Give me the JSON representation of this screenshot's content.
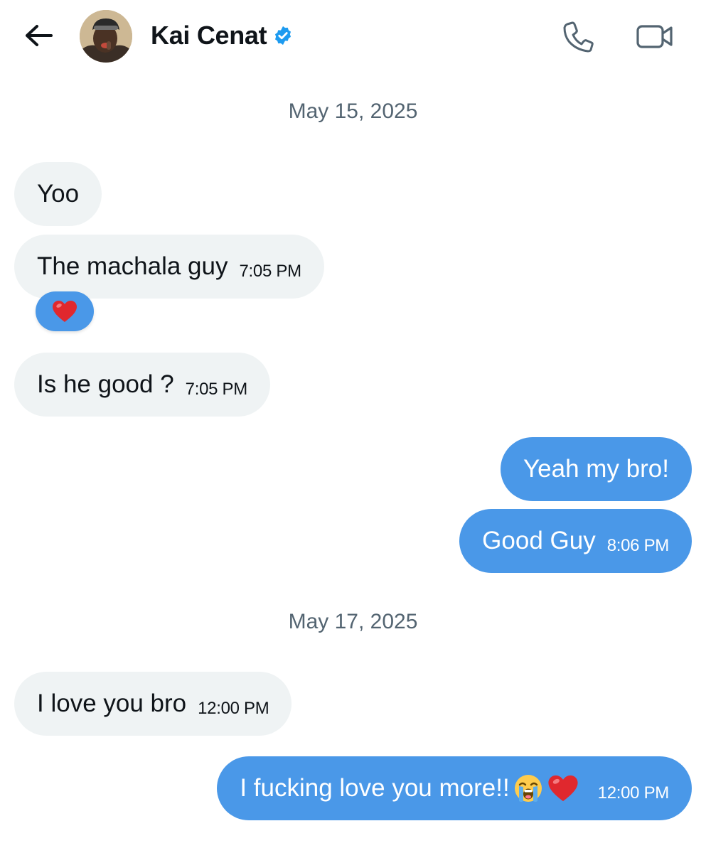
{
  "header": {
    "back_icon": "arrow-left-icon",
    "contact_name": "Kai Cenat",
    "verified_icon": "verified-badge-icon",
    "call_icon": "phone-icon",
    "video_icon": "video-camera-icon"
  },
  "colors": {
    "outgoing_bubble": "#4a98e8",
    "incoming_bubble": "#eff3f4",
    "verified_blue": "#1d9bf0",
    "date_text": "#536471"
  },
  "conversation": {
    "date_1": "May 15, 2025",
    "date_2": "May 17, 2025",
    "messages": [
      {
        "direction": "incoming",
        "text": "Yoo",
        "time": ""
      },
      {
        "direction": "incoming",
        "text": "The machala guy",
        "time": "7:05 PM",
        "reaction": "red-heart"
      },
      {
        "direction": "incoming",
        "text": "Is he good ?",
        "time": "7:05 PM"
      },
      {
        "direction": "outgoing",
        "text": "Yeah my bro!",
        "time": ""
      },
      {
        "direction": "outgoing",
        "text": "Good Guy",
        "time": "8:06 PM"
      },
      {
        "direction": "incoming",
        "text": "I love you bro",
        "time": "12:00 PM"
      },
      {
        "direction": "outgoing",
        "text": "I fucking love you more!!",
        "emojis": [
          "loudly-crying-face",
          "red-heart"
        ],
        "time": "12:00 PM"
      }
    ]
  }
}
